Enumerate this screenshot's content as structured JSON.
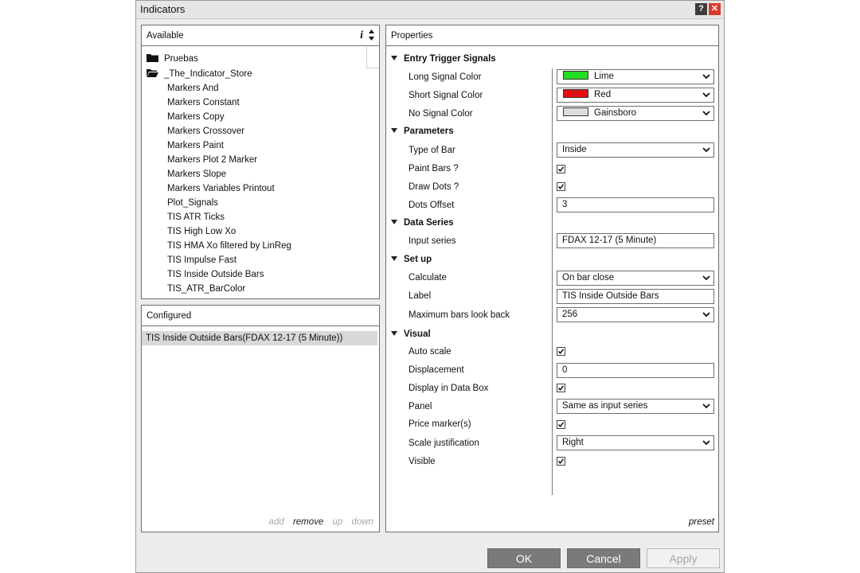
{
  "window": {
    "title": "Indicators",
    "help_label": "?",
    "close_label": "✕"
  },
  "available": {
    "header": "Available",
    "info_label": "i",
    "folders": [
      {
        "label": "Pruebas",
        "icon": "folder-closed-icon"
      },
      {
        "label": "_The_Indicator_Store",
        "icon": "folder-open-icon"
      }
    ],
    "items": [
      "Markers And",
      "Markers Constant",
      "Markers Copy",
      "Markers Crossover",
      "Markers Paint",
      "Markers Plot 2 Marker",
      "Markers Slope",
      "Markers Variables Printout",
      "Plot_Signals",
      "TIS ATR Ticks",
      "TIS High Low Xo",
      "TIS HMA Xo filtered by LinReg",
      "TIS Impulse Fast",
      "TIS Inside Outside Bars",
      "TIS_ATR_BarColor"
    ]
  },
  "configured": {
    "header": "Configured",
    "items": [
      "TIS Inside Outside Bars(FDAX 12-17 (5 Minute))"
    ],
    "actions": {
      "add": "add",
      "remove": "remove",
      "up": "up",
      "down": "down"
    }
  },
  "properties": {
    "header": "Properties",
    "groups": {
      "entry": "Entry Trigger Signals",
      "parameters": "Parameters",
      "data_series": "Data Series",
      "setup": "Set up",
      "visual": "Visual"
    },
    "labels": {
      "long_signal_color": "Long Signal Color",
      "short_signal_color": "Short Signal Color",
      "no_signal_color": "No Signal Color",
      "type_of_bar": "Type of Bar",
      "paint_bars": "Paint Bars ?",
      "draw_dots": "Draw Dots ?",
      "dots_offset": "Dots Offset",
      "input_series": "Input series",
      "calculate": "Calculate",
      "label": "Label",
      "max_bars": "Maximum bars look back",
      "auto_scale": "Auto scale",
      "displacement": "Displacement",
      "display_data_box": "Display in Data Box",
      "panel": "Panel",
      "price_markers": "Price marker(s)",
      "scale_justification": "Scale justification",
      "visible": "Visible"
    },
    "values": {
      "long_signal_color": "Lime",
      "short_signal_color": "Red",
      "no_signal_color": "Gainsboro",
      "type_of_bar": "Inside",
      "dots_offset": "3",
      "input_series": "FDAX 12-17 (5 Minute)",
      "calculate": "On bar close",
      "label": "TIS Inside Outside Bars",
      "max_bars": "256",
      "displacement": "0",
      "panel": "Same as input series",
      "scale_justification": "Right"
    },
    "checked": {
      "paint_bars": true,
      "draw_dots": true,
      "auto_scale": true,
      "display_data_box": true,
      "price_markers": true,
      "visible": true
    },
    "colors": {
      "lime": "#22dd22",
      "red": "#e01010",
      "gainsboro": "#dcdcdc"
    },
    "preset": "preset"
  },
  "buttons": {
    "ok": "OK",
    "cancel": "Cancel",
    "apply": "Apply"
  }
}
